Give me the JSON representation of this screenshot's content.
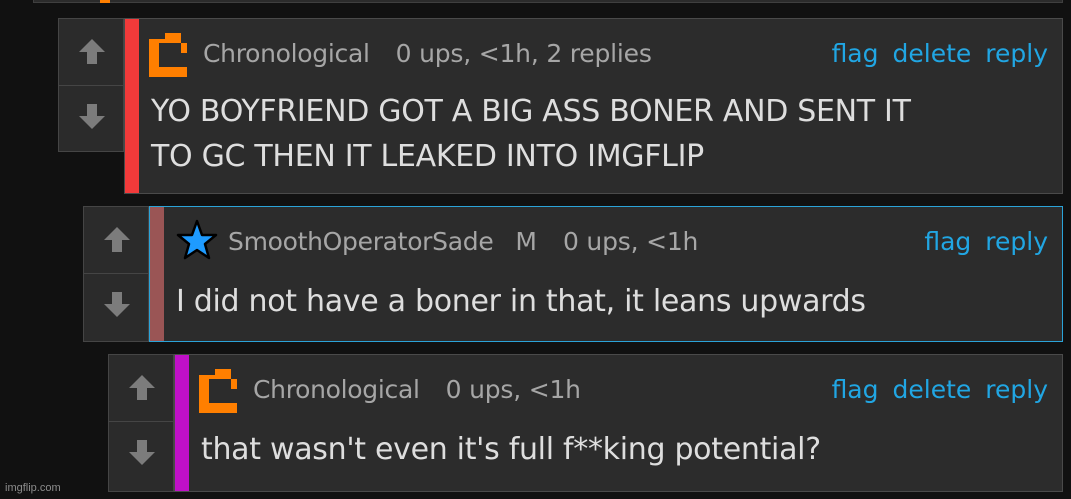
{
  "colors": {
    "background": "#111111",
    "link": "#21a6e3",
    "username": "#a6a6a6",
    "text": "#dedede",
    "accent_red": "#f23a3a",
    "accent_brown": "#9a5555",
    "accent_magenta": "#c010c8",
    "logo_orange": "#ff7f00",
    "star_blue": "#1e9bff"
  },
  "comments": [
    {
      "username": "Chronological",
      "badge_icon": "orange-flag-logo-icon",
      "meta": "0 ups, <1h, 2 replies",
      "actions": [
        "flag",
        "delete",
        "reply"
      ],
      "text_lines": [
        "YO BOYFRIEND GOT A BIG ASS BONER AND SENT IT",
        "TO GC THEN IT LEAKED INTO IMGFLIP"
      ]
    },
    {
      "username": "SmoothOperatorSade",
      "badge_icon": "blue-star-icon",
      "mod_badge": "M",
      "meta": "0 ups, <1h",
      "actions": [
        "flag",
        "reply"
      ],
      "text_lines": [
        "I did not have a boner in that, it leans upwards"
      ]
    },
    {
      "username": "Chronological",
      "badge_icon": "orange-flag-logo-icon",
      "meta": "0 ups, <1h",
      "actions": [
        "flag",
        "delete",
        "reply"
      ],
      "text_lines": [
        "that wasn't even it's full f**king potential?"
      ]
    }
  ],
  "watermark": "imgflip.com"
}
